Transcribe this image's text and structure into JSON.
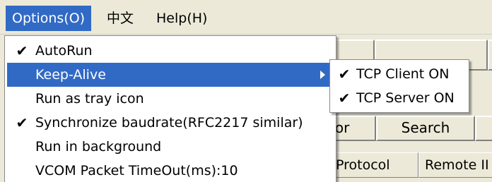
{
  "menubar": {
    "items": [
      {
        "label": "Options(O)"
      },
      {
        "label": "中文"
      },
      {
        "label": "Help(H)"
      }
    ]
  },
  "background": {
    "buttons": [
      {
        "label": "tor"
      },
      {
        "label": "Search"
      }
    ],
    "table_headers": [
      {
        "label": "Protocol"
      },
      {
        "label": "Remote II"
      }
    ]
  },
  "options_menu": {
    "items": [
      {
        "label": "AutoRun",
        "checked": true
      },
      {
        "label": "Keep-Alive",
        "checked": false,
        "has_submenu": true,
        "highlighted": true
      },
      {
        "label": "Run as tray icon",
        "checked": false
      },
      {
        "label": "Synchronize baudrate(RFC2217 similar)",
        "checked": true
      },
      {
        "label": "Run in background",
        "checked": false
      },
      {
        "label": "VCOM Packet TimeOut(ms):10",
        "checked": false
      }
    ]
  },
  "keepalive_submenu": {
    "items": [
      {
        "label": "TCP Client ON",
        "checked": true
      },
      {
        "label": "TCP Server ON",
        "checked": true
      }
    ]
  },
  "icons": {
    "check": "✔"
  },
  "colors": {
    "highlight": "#316ac5",
    "menu_bg": "#ffffff",
    "window_bg": "#ece9d8"
  }
}
